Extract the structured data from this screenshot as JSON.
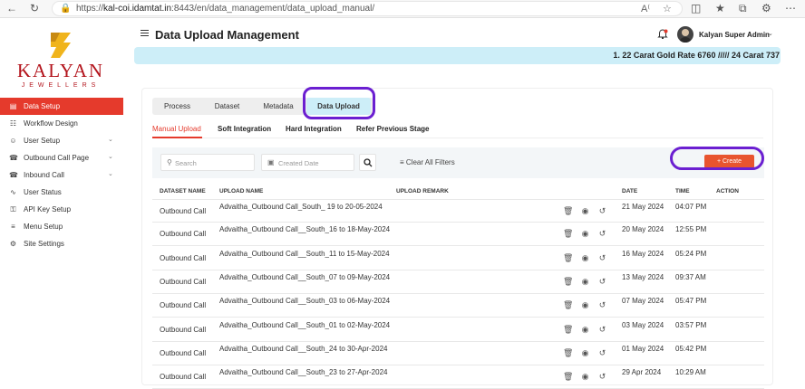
{
  "browser": {
    "url_prefix": "https://",
    "url_host": "kal-coi.idamtat.in",
    "url_rest": ":8443/en/data_management/data_upload_manual/"
  },
  "sidebar": {
    "logo_text": "KALYAN",
    "logo_sub": "JEWELLERS",
    "items": [
      {
        "label": "Data Setup",
        "icon": "database-icon",
        "active": true,
        "has_chevron": false
      },
      {
        "label": "Workflow Design",
        "icon": "workflow-icon",
        "active": false,
        "has_chevron": false
      },
      {
        "label": "User Setup",
        "icon": "user-icon",
        "active": false,
        "has_chevron": true
      },
      {
        "label": "Outbound Call Page",
        "icon": "outbound-call-icon",
        "active": false,
        "has_chevron": true
      },
      {
        "label": "Inbound Call",
        "icon": "inbound-call-icon",
        "active": false,
        "has_chevron": true
      },
      {
        "label": "User Status",
        "icon": "status-pulse-icon",
        "active": false,
        "has_chevron": false
      },
      {
        "label": "API Key Setup",
        "icon": "key-icon",
        "active": false,
        "has_chevron": false
      },
      {
        "label": "Menu Setup",
        "icon": "menu-icon",
        "active": false,
        "has_chevron": false
      },
      {
        "label": "Site Settings",
        "icon": "gear-icon",
        "active": false,
        "has_chevron": false
      }
    ]
  },
  "header": {
    "title": "Data Upload Management",
    "user_name": "Kalyan Super Admin"
  },
  "ticker": {
    "text": "1. 22 Carat Gold Rate 6760 ///// 24 Carat 737"
  },
  "tabs": [
    "Process",
    "Dataset",
    "Metadata",
    "Data Upload"
  ],
  "active_tab": "Data Upload",
  "subtabs": [
    "Manual Upload",
    "Soft Integration",
    "Hard Integration",
    "Refer Previous Stage"
  ],
  "active_subtab": "Manual Upload",
  "filters": {
    "search_placeholder": "Search",
    "date_placeholder": "Created Date",
    "clear_label": "Clear All Filters",
    "create_label": "+ Create"
  },
  "table": {
    "headers": [
      "DATASET NAME",
      "UPLOAD NAME",
      "UPLOAD REMARK",
      "DATE",
      "TIME",
      "ACTION"
    ],
    "rows": [
      {
        "dataset": "Outbound Call",
        "upload": "Advaitha_Outbound Call_South_ 19 to 20-05-2024",
        "remark": "",
        "date": "21 May 2024",
        "time": "04:07 PM"
      },
      {
        "dataset": "Outbound Call",
        "upload": "Advaitha_Outbound Call__South_16 to 18-May-2024",
        "remark": "",
        "date": "20 May 2024",
        "time": "12:55 PM"
      },
      {
        "dataset": "Outbound Call",
        "upload": "Advaitha_Outbound Call__South_11 to 15-May-2024",
        "remark": "",
        "date": "16 May 2024",
        "time": "05:24 PM"
      },
      {
        "dataset": "Outbound Call",
        "upload": "Advaitha_Outbound Call__South_07 to 09-May-2024",
        "remark": "",
        "date": "13 May 2024",
        "time": "09:37 AM"
      },
      {
        "dataset": "Outbound Call",
        "upload": "Advaitha_Outbound Call__South_03 to 06-May-2024",
        "remark": "",
        "date": "07 May 2024",
        "time": "05:47 PM"
      },
      {
        "dataset": "Outbound Call",
        "upload": "Advaitha_Outbound Call__South_01 to 02-May-2024",
        "remark": "",
        "date": "03 May 2024",
        "time": "03:57 PM"
      },
      {
        "dataset": "Outbound Call",
        "upload": "Advaitha_Outbound Call__South_24 to 30-Apr-2024",
        "remark": "",
        "date": "01 May 2024",
        "time": "05:42 PM"
      },
      {
        "dataset": "Outbound Call",
        "upload": "Advaitha_Outbound Call__South_23 to 27-Apr-2024",
        "remark": "",
        "date": "29 Apr 2024",
        "time": "10:29 AM"
      }
    ]
  },
  "colors": {
    "accent": "#e53a2c",
    "active_tab_bg": "#cdeef8",
    "annotation": "#6b1fd1"
  }
}
